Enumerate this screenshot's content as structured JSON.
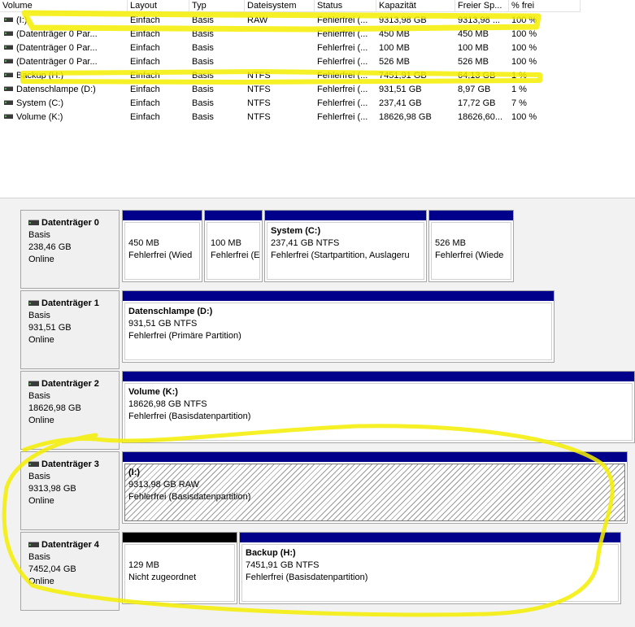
{
  "table": {
    "columns": [
      "Volume",
      "Layout",
      "Typ",
      "Dateisystem",
      "Status",
      "Kapazität",
      "Freier Sp...",
      "% frei"
    ],
    "rows": [
      {
        "volume": "(I:)",
        "layout": "Einfach",
        "typ": "Basis",
        "fs": "RAW",
        "status": "Fehlerfrei (...",
        "kap": "9313,98 GB",
        "frei": "9313,98 ...",
        "pct": "100 %"
      },
      {
        "volume": "(Datenträger 0 Par...",
        "layout": "Einfach",
        "typ": "Basis",
        "fs": "",
        "status": "Fehlerfrei (...",
        "kap": "450 MB",
        "frei": "450 MB",
        "pct": "100 %"
      },
      {
        "volume": "(Datenträger 0 Par...",
        "layout": "Einfach",
        "typ": "Basis",
        "fs": "",
        "status": "Fehlerfrei (...",
        "kap": "100 MB",
        "frei": "100 MB",
        "pct": "100 %"
      },
      {
        "volume": "(Datenträger 0 Par...",
        "layout": "Einfach",
        "typ": "Basis",
        "fs": "",
        "status": "Fehlerfrei (...",
        "kap": "526 MB",
        "frei": "526 MB",
        "pct": "100 %"
      },
      {
        "volume": "Backup (H:)",
        "layout": "Einfach",
        "typ": "Basis",
        "fs": "NTFS",
        "status": "Fehlerfrei (...",
        "kap": "7451,91 GB",
        "frei": "64,13 GB",
        "pct": "1 %"
      },
      {
        "volume": "Datenschlampe (D:)",
        "layout": "Einfach",
        "typ": "Basis",
        "fs": "NTFS",
        "status": "Fehlerfrei (...",
        "kap": "931,51 GB",
        "frei": "8,97 GB",
        "pct": "1 %"
      },
      {
        "volume": "System (C:)",
        "layout": "Einfach",
        "typ": "Basis",
        "fs": "NTFS",
        "status": "Fehlerfrei (...",
        "kap": "237,41 GB",
        "frei": "17,72 GB",
        "pct": "7 %"
      },
      {
        "volume": "Volume (K:)",
        "layout": "Einfach",
        "typ": "Basis",
        "fs": "NTFS",
        "status": "Fehlerfrei (...",
        "kap": "18626,98 GB",
        "frei": "18626,60...",
        "pct": "100 %"
      }
    ]
  },
  "disks": [
    {
      "name": "Datenträger 0",
      "type": "Basis",
      "size": "238,46 GB",
      "state": "Online",
      "partitions": [
        {
          "name": "",
          "line1": "450 MB",
          "line2": "Fehlerfrei (Wied"
        },
        {
          "name": "",
          "line1": "100 MB",
          "line2": "Fehlerfrei (E"
        },
        {
          "name": "System  (C:)",
          "line1": "237,41 GB NTFS",
          "line2": "Fehlerfrei (Startpartition, Auslageru"
        },
        {
          "name": "",
          "line1": "526 MB",
          "line2": "Fehlerfrei (Wiede"
        }
      ]
    },
    {
      "name": "Datenträger 1",
      "type": "Basis",
      "size": "931,51 GB",
      "state": "Online",
      "partitions": [
        {
          "name": "Datenschlampe  (D:)",
          "line1": "931,51 GB NTFS",
          "line2": "Fehlerfrei (Primäre Partition)"
        }
      ]
    },
    {
      "name": "Datenträger 2",
      "type": "Basis",
      "size": "18626,98 GB",
      "state": "Online",
      "partitions": [
        {
          "name": "Volume  (K:)",
          "line1": "18626,98 GB NTFS",
          "line2": "Fehlerfrei (Basisdatenpartition)"
        }
      ]
    },
    {
      "name": "Datenträger 3",
      "type": "Basis",
      "size": "9313,98 GB",
      "state": "Online",
      "partitions": [
        {
          "name": "(I:)",
          "line1": "9313,98 GB RAW",
          "line2": "Fehlerfrei (Basisdatenpartition)"
        }
      ]
    },
    {
      "name": "Datenträger 4",
      "type": "Basis",
      "size": "7452,04 GB",
      "state": "Online",
      "partitions": [
        {
          "name": "",
          "line1": "129 MB",
          "line2": "Nicht zugeordnet"
        },
        {
          "name": "Backup  (H:)",
          "line1": "7451,91 GB NTFS",
          "line2": "Fehlerfrei (Basisdatenpartition)"
        }
      ]
    }
  ],
  "colors": {
    "partition_bar": "#00008b",
    "unallocated_bar": "#000000",
    "highlight": "#f5ef00"
  }
}
